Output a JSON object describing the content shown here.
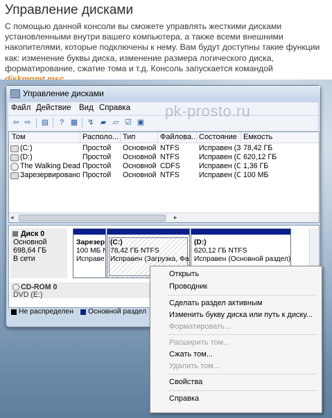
{
  "article": {
    "title": "Управление дисками",
    "text_before": "С помощью данной консоли вы сможете управлять жесткими дисками установленными внутри вашего компьютера, а также всеми внешними накопителями, которые подключены к нему. Вам будут доступны такие функции как: изменение буквы диска, изменение размера логического диска, форматирование, сжатие тома и т.д. Консоль запускается командой ",
    "command": "diskmgmt.msc",
    "text_after": "."
  },
  "watermark": "pk-prosto.ru",
  "window": {
    "title": "Управление дисками",
    "menu": [
      "Файл",
      "Действие",
      "Вид",
      "Справка"
    ]
  },
  "volume_list": {
    "columns": [
      "Том",
      "Располо...",
      "Тип",
      "Файлова...",
      "Состояние",
      "Емкость"
    ],
    "rows": [
      {
        "icon": "volume-icon",
        "name": "(C:)",
        "layout": "Простой",
        "type": "Основной",
        "fs": "NTFS",
        "status": "Исправен (З...",
        "capacity": "78,42 ГБ"
      },
      {
        "icon": "volume-icon",
        "name": "(D:)",
        "layout": "Простой",
        "type": "Основной",
        "fs": "NTFS",
        "status": "Исправен (О...",
        "capacity": "620,12 ГБ"
      },
      {
        "icon": "cd-icon",
        "name": "The Walking Dead...",
        "layout": "Простой",
        "type": "Основной",
        "fs": "CDFS",
        "status": "Исправен (О...",
        "capacity": "1,36 ГБ"
      },
      {
        "icon": "volume-icon",
        "name": "Зарезервировано...",
        "layout": "Простой",
        "type": "Основной",
        "fs": "NTFS",
        "status": "Исправен (С...",
        "capacity": "100 МБ"
      }
    ]
  },
  "disk0": {
    "name": "Диск 0",
    "type": "Основной",
    "size": "698,64 ГБ",
    "status": "В сети",
    "partitions": [
      {
        "line1": "Зарезер",
        "line2": "100 МБ N",
        "line3": "Исправе"
      },
      {
        "line1": "(C:)",
        "line2": "78,42 ГБ NTFS",
        "line3": "Исправен (Загрузка, Фай."
      },
      {
        "line1": "(D:)",
        "line2": "620,12 ГБ NTFS",
        "line3": "Исправен (Основной раздел)"
      }
    ]
  },
  "cdrom0": {
    "name": "CD-ROM 0",
    "drive": "DVD (E:)"
  },
  "legend": [
    {
      "label": "Не распределен",
      "color": "#000000"
    },
    {
      "label": "Основной раздел",
      "color": "#0a1e8c"
    }
  ],
  "context_menu": {
    "items": [
      {
        "label": "Открыть",
        "enabled": true
      },
      {
        "label": "Проводник",
        "enabled": true
      },
      {
        "label": "Сделать раздел активным",
        "enabled": true
      },
      {
        "label": "Изменить букву диска или путь к диску...",
        "enabled": true
      },
      {
        "label": "Форматировать...",
        "enabled": false
      },
      {
        "label": "Расширить том...",
        "enabled": false
      },
      {
        "label": "Сжать том...",
        "enabled": true
      },
      {
        "label": "Удалить том...",
        "enabled": false
      },
      {
        "label": "Свойства",
        "enabled": true
      },
      {
        "label": "Справка",
        "enabled": true
      }
    ]
  },
  "colors": {
    "primary_partition": "#0a1e8c",
    "command_highlight": "#e8861a"
  }
}
